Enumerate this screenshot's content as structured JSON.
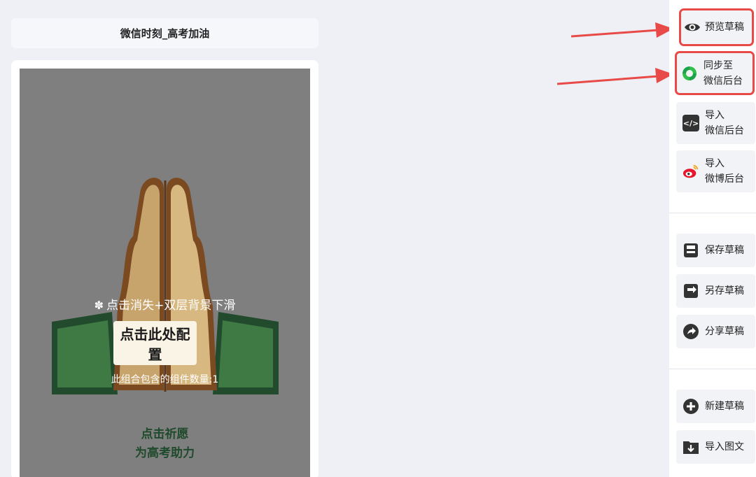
{
  "editor": {
    "article_title": "微信时刻_高考加油"
  },
  "preview": {
    "hint_text": "点击消失+双层背景下滑",
    "config_button": "点击此处配置",
    "component_count": "此组合包含的组件数量:1",
    "pray_line1": "点击祈愿",
    "pray_line2": "为高考助力"
  },
  "sidebar": {
    "preview_draft": "预览草稿",
    "sync_line1": "同步至",
    "sync_line2": "微信后台",
    "import_wechat_line1": "导入",
    "import_wechat_line2": "微信后台",
    "import_weibo_line1": "导入",
    "import_weibo_line2": "微博后台",
    "save_draft": "保存草稿",
    "save_as_draft": "另存草稿",
    "share_draft": "分享草稿",
    "new_draft": "新建草稿",
    "import_article": "导入图文"
  },
  "colors": {
    "highlight": "#e84a48",
    "canvas_bg": "#7f7f7f",
    "pray_text": "#1f4a2b",
    "sidebar_button_bg": "#f2f3f6"
  }
}
